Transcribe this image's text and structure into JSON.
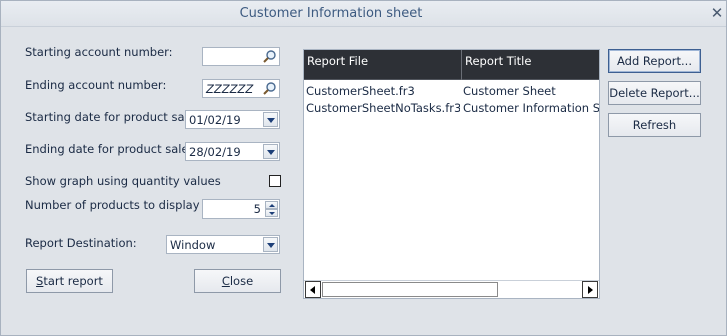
{
  "window": {
    "title": "Customer Information sheet",
    "close_glyph": "✕"
  },
  "form": {
    "start_account_label": "Starting account number:",
    "start_account_value": "",
    "end_account_label": "Ending account number:",
    "end_account_value": "ZZZZZZ",
    "start_date_label": "Starting date for product sales:",
    "start_date_value": "01/02/19",
    "end_date_label": "Ending date for product sales:",
    "end_date_value": "28/02/19",
    "graph_label": "Show graph using quantity values",
    "graph_checked": false,
    "top_n_label": "Number of products to display (top n)",
    "top_n_value": "5",
    "destination_label": "Report Destination:",
    "destination_value": "Window"
  },
  "buttons": {
    "start_report_prefix": "S",
    "start_report_rest": "tart report",
    "close_prefix": "C",
    "close_rest": "lose",
    "add_report": "Add Report...",
    "delete_report": "Delete Report...",
    "refresh": "Refresh"
  },
  "grid": {
    "columns": [
      "Report File",
      "Report Title"
    ],
    "rows": [
      [
        "CustomerSheet.fr3",
        "Customer Sheet"
      ],
      [
        "CustomerSheetNoTasks.fr3",
        "Customer Information Sheet"
      ]
    ]
  },
  "icons": {
    "lookup": "magnifier-icon",
    "dropdown": "chevron-down-icon"
  }
}
